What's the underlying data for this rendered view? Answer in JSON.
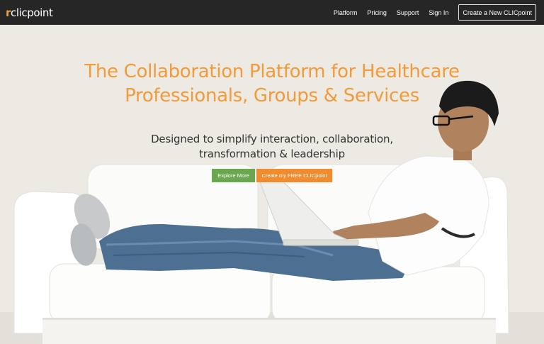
{
  "brand": {
    "logo_text": "clicpoint",
    "logo_mark": "r",
    "accent_color": "#f39a3a"
  },
  "nav": {
    "items": [
      {
        "label": "Platform"
      },
      {
        "label": "Pricing"
      },
      {
        "label": "Support"
      },
      {
        "label": "Sign In"
      }
    ],
    "cta_label": "Create a New CLICpoint"
  },
  "hero": {
    "headline_line1": "The Collaboration Platform for Healthcare",
    "headline_line2": "Professionals, Groups & Services",
    "subhead_line1": "Designed to simplify interaction, collaboration,",
    "subhead_line2": "transformation & leadership",
    "explore_label": "Explore More",
    "free_label": "Create my FREE CLICpoint",
    "explore_color": "#6aa84f",
    "free_color": "#f08c2e"
  }
}
